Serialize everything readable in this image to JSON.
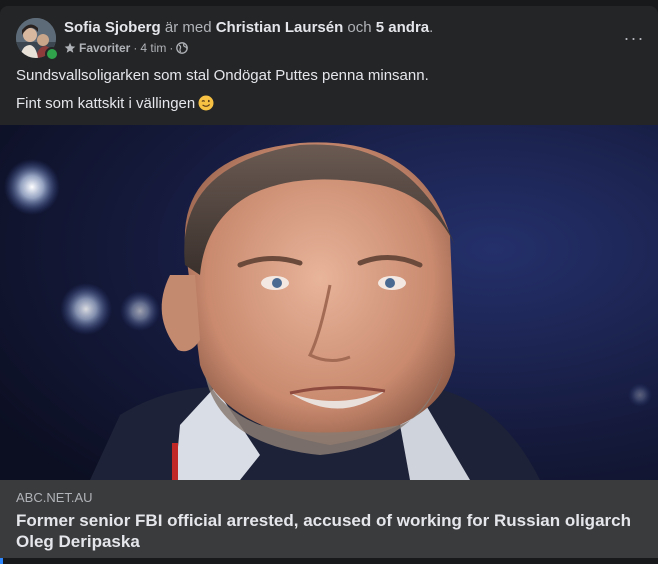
{
  "post": {
    "author": "Sofia Sjoberg",
    "with_text": "är med",
    "tagged_person": "Christian Laursén",
    "and_text": "och",
    "others": "5 andra",
    "period": ".",
    "audience_label": "Favoriter",
    "separator": "·",
    "timestamp": "4 tim",
    "privacy_icon": "globe-icon",
    "more_icon": "more-options-icon",
    "more_label": "···",
    "text_line1": "Sundsvallsoligarken som stal Ondögat Puttes penna minsann.",
    "text_line2": "Fint som kattskit i vällingen",
    "emoji": "winking-face-emoji"
  },
  "link_preview": {
    "domain": "ABC.NET.AU",
    "title": "Former senior FBI official arrested, accused of working for Russian oligarch Oleg Deripaska"
  },
  "colors": {
    "background": "#18191a",
    "card": "#242526",
    "link_card": "#3a3b3c",
    "primary_text": "#e4e6eb",
    "secondary_text": "#b0b3b8",
    "online": "#31a24c"
  }
}
